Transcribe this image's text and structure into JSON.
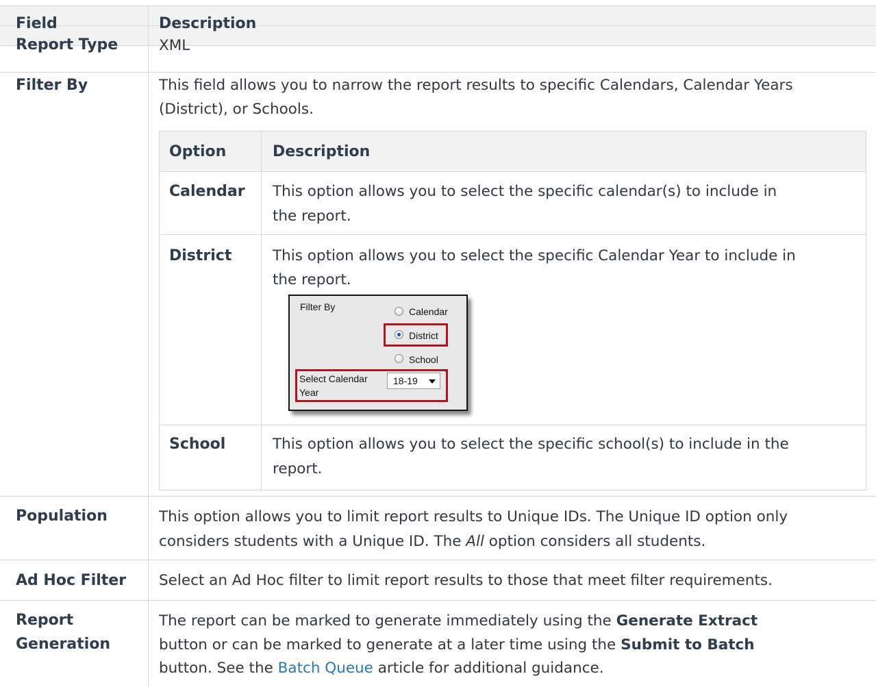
{
  "header": {
    "field": "Field",
    "description": "Description"
  },
  "rows": {
    "report_type": {
      "field": "Report Type",
      "description": "XML"
    },
    "filter_by": {
      "field": "Filter By",
      "desc_line1": "This field allows you to narrow the report results to specific Calendars, Calendar Years",
      "desc_line2": "(District), or Schools.",
      "options_table": {
        "header": {
          "option": "Option",
          "description": "Description"
        },
        "calendar": {
          "option": "Calendar",
          "line1": "This option allows you to select the specific calendar(s) to include in",
          "line2": "the report."
        },
        "district": {
          "option": "District",
          "line1": "This option allows you to select the specific Calendar Year to include in",
          "line2": "the report."
        },
        "school": {
          "option": "School",
          "line1": "This option allows you to select the specific school(s) to include in the",
          "line2": "report."
        }
      },
      "screenshot": {
        "label": "Filter By",
        "radio_calendar": "Calendar",
        "radio_district": "District",
        "radio_school": "School",
        "select_label_line1": "Select Calendar",
        "select_label_line2": "Year",
        "select_value": "18-19",
        "selected_radio": "District"
      }
    },
    "population": {
      "field": "Population",
      "line1": "This option allows you to limit report results to Unique IDs. The Unique ID option only",
      "line2_a": "considers students with a Unique ID. The ",
      "line2_italic": "All",
      "line2_b": " option considers all students."
    },
    "ad_hoc": {
      "field": "Ad Hoc Filter",
      "description": "Select an Ad Hoc filter to limit report results to those that meet filter requirements."
    },
    "report_generation": {
      "field_line1": "Report",
      "field_line2": "Generation",
      "line1_a": "The report can be marked to generate immediately using the ",
      "line1_bold": "Generate Extract",
      "line2_a": "button or can be marked to generate at a later time using the ",
      "line2_bold": "Submit to Batch",
      "line3_a": "button. See the ",
      "line3_link": "Batch Queue",
      "line3_b": " article for additional guidance."
    }
  }
}
